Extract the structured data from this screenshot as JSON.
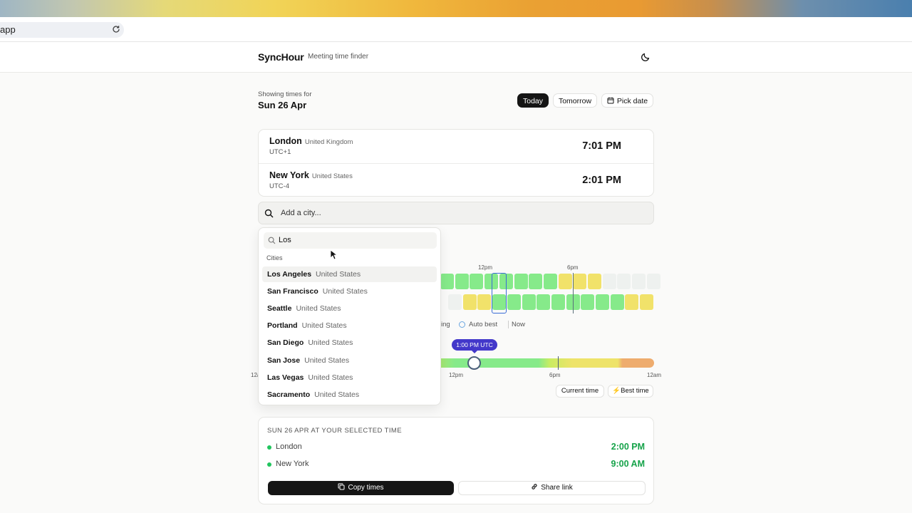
{
  "browser": {
    "url_fragment": "app"
  },
  "header": {
    "brand": "SyncHour",
    "tagline": "Meeting time finder"
  },
  "date_bar": {
    "label": "Showing times for",
    "date": "Sun 26 Apr",
    "buttons": {
      "today": "Today",
      "tomorrow": "Tomorrow",
      "pick_date": "Pick date"
    },
    "selected": "Today"
  },
  "cities": [
    {
      "name": "London",
      "country": "United Kingdom",
      "offset": "UTC+1",
      "time": "7:01 PM"
    },
    {
      "name": "New York",
      "country": "United States",
      "offset": "UTC-4",
      "time": "2:01 PM"
    }
  ],
  "add_city": {
    "placeholder": "Add a city..."
  },
  "search_dropdown": {
    "query": "Los",
    "group_label": "Cities",
    "results": [
      {
        "city": "Los Angeles",
        "country": "United States"
      },
      {
        "city": "San Francisco",
        "country": "United States"
      },
      {
        "city": "Seattle",
        "country": "United States"
      },
      {
        "city": "Portland",
        "country": "United States"
      },
      {
        "city": "San Diego",
        "country": "United States"
      },
      {
        "city": "San Jose",
        "country": "United States"
      },
      {
        "city": "Las Vegas",
        "country": "United States"
      },
      {
        "city": "Sacramento",
        "country": "United States"
      }
    ]
  },
  "timeline": {
    "hour_labels": {
      "noon": "12pm",
      "six_pm": "6pm"
    },
    "row_london": [
      "green",
      "green",
      "green",
      "green",
      "green",
      "green",
      "green",
      "green",
      "yellow",
      "yellow",
      "yellow",
      "light",
      "light",
      "light",
      "light"
    ],
    "row_newyork": [
      "light",
      "yellow",
      "yellow",
      "green",
      "green",
      "green",
      "green",
      "green",
      "green",
      "green",
      "green",
      "green",
      "yellow",
      "yellow"
    ],
    "legend": {
      "partial": "ing",
      "auto_best": "Auto best",
      "now": "Now"
    },
    "colors": {
      "green": "#86ea8a",
      "yellow": "#f1e26a",
      "light": "#eef1ef",
      "selection": "#3a6bd6"
    }
  },
  "slider": {
    "badge": "1:00 PM UTC",
    "selected_utc_hour": 13,
    "ticks": {
      "start_partial": "12a",
      "noon": "12pm",
      "six_pm": "6pm",
      "end": "12am"
    },
    "buttons": {
      "current_time": "Current time",
      "best_time": "Best time"
    }
  },
  "summary": {
    "title": "SUN 26 APR AT YOUR SELECTED TIME",
    "rows": [
      {
        "city": "London",
        "time": "2:00 PM"
      },
      {
        "city": "New York",
        "time": "9:00 AM"
      }
    ],
    "buttons": {
      "copy": "Copy times",
      "share": "Share link"
    },
    "accent": "#16a34a"
  }
}
